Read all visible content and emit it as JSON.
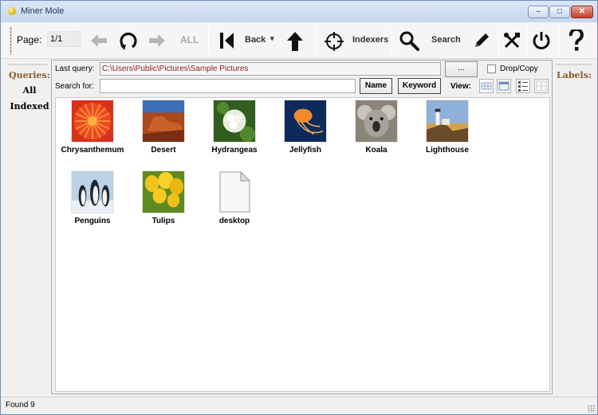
{
  "window": {
    "title": "Miner Mole",
    "minimize_glyph": "‒",
    "maximize_glyph": "□",
    "close_glyph": "✕"
  },
  "toolbar": {
    "page_label": "Page:",
    "page_value": "1/1",
    "all_label": "ALL",
    "back_label": "Back",
    "back_dropdown": "▾",
    "indexers_label": "Indexers",
    "search_label": "Search",
    "icons": [
      "arrow-left-icon",
      "refresh-icon",
      "arrow-right-icon",
      "skip-back-icon",
      "arrow-up-icon",
      "crosshair-icon",
      "search-icon",
      "pencil-icon",
      "tools-icon",
      "power-icon",
      "help-icon"
    ]
  },
  "left_panel": {
    "heading": "Queries:",
    "items": [
      "All",
      "Indexed"
    ]
  },
  "right_panel": {
    "heading": "Labels:"
  },
  "query": {
    "last_query_label": "Last query:",
    "last_query_value": "C:\\Users\\Public\\Pictures\\Sample Pictures",
    "browse_label": "...",
    "drop_copy_label": "Drop/Copy",
    "drop_copy_checked": false,
    "search_label": "Search for:",
    "search_value": "",
    "name_button": "Name",
    "keyword_button": "Keyword",
    "view_label": "View:"
  },
  "files": [
    {
      "name": "Chrysanthemum",
      "icon": "chrysanthemum-thumbnail"
    },
    {
      "name": "Desert",
      "icon": "desert-thumbnail"
    },
    {
      "name": "Hydrangeas",
      "icon": "hydrangeas-thumbnail"
    },
    {
      "name": "Jellyfish",
      "icon": "jellyfish-thumbnail"
    },
    {
      "name": "Koala",
      "icon": "koala-thumbnail"
    },
    {
      "name": "Lighthouse",
      "icon": "lighthouse-thumbnail"
    },
    {
      "name": "Penguins",
      "icon": "penguins-thumbnail"
    },
    {
      "name": "Tulips",
      "icon": "tulips-thumbnail"
    },
    {
      "name": "desktop",
      "icon": "blank-file-icon"
    }
  ],
  "status": {
    "text": "Found 9"
  },
  "colors": {
    "query_path": "#8b2323",
    "panel_heading": "#8b5a2b",
    "title_bar": "#c5d7ee"
  }
}
